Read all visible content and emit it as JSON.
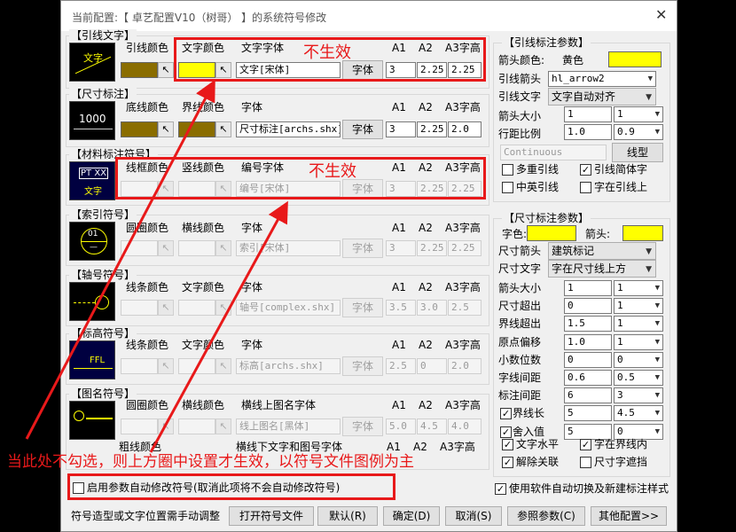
{
  "window": {
    "title": "当前配置:【 卓艺配置V10（树哥） 】的系统符号修改",
    "close": "✕"
  },
  "sections": {
    "leader_text": {
      "legend": "【引线文字】",
      "line_color": "引线颜色",
      "text_color": "文字颜色",
      "text_font": "文字字体",
      "font_value": "文字[宋体]",
      "font_btn": "字体",
      "a1": "A1",
      "a2": "A2",
      "a3": "A3字高",
      "a1_val": "3",
      "a2_val": "2.25",
      "a3_val": "2.25",
      "thumb_text": "文字",
      "swatch_line": "#8a6d00",
      "swatch_text": "#ffff00"
    },
    "dimension": {
      "legend": "【尺寸标注】",
      "base_color": "底线颜色",
      "ext_color": "界线颜色",
      "font": "字体",
      "font_value": "尺寸标注[archs.shx]",
      "font_btn": "字体",
      "a1": "A1",
      "a2": "A2",
      "a3": "A3字高",
      "a1_val": "3",
      "a2_val": "2.25",
      "a3_val": "2.0",
      "thumb_text": "1000",
      "swatch": "#8a6d00"
    },
    "material": {
      "legend": "【材料标注符号】",
      "frame_color": "线框颜色",
      "vline_color": "竖线颜色",
      "num_font": "编号字体",
      "font_value": "编号[宋体]",
      "font_btn": "字体",
      "a1": "A1",
      "a2": "A2",
      "a3": "A3字高",
      "a1_val": "3",
      "a2_val": "2.25",
      "a3_val": "2.25",
      "thumb_top": "PT XX",
      "thumb_bottom": "文字"
    },
    "index": {
      "legend": "【索引符号】",
      "circle_color": "圆圈颜色",
      "line_color": "横线颜色",
      "font": "字体",
      "font_value": "索引[宋体]",
      "font_btn": "字体",
      "a1": "A1",
      "a2": "A2",
      "a3": "A3字高",
      "a1_val": "3",
      "a2_val": "2.25",
      "a3_val": "2.25",
      "thumb_top": "01",
      "thumb_bottom": "—"
    },
    "axis": {
      "legend": "【轴号符号】",
      "line_color": "线条颜色",
      "text_color": "文字颜色",
      "font": "字体",
      "font_value": "轴号[complex.shx]",
      "font_btn": "字体",
      "a1": "A1",
      "a2": "A2",
      "a3": "A3字高",
      "a1_val": "3.5",
      "a2_val": "3.0",
      "a3_val": "2.5"
    },
    "elevation": {
      "legend": "【标高符号】",
      "line_color": "线条颜色",
      "text_color": "文字颜色",
      "font": "字体",
      "font_value": "标高[archs.shx]",
      "font_btn": "字体",
      "a1": "A1",
      "a2": "A2",
      "a3": "A3字高",
      "a1_val": "2.5",
      "a2_val": "0",
      "a3_val": "2.0",
      "thumb_text": "FFL"
    },
    "drawing_name": {
      "legend": "【图名符号】",
      "circle_color": "圆圈颜色",
      "line_color": "横线颜色",
      "top_font": "横线上图名字体",
      "font_value": "线上图名[黑体]",
      "font_btn": "字体",
      "a1": "A1",
      "a2": "A2",
      "a3": "A3字高",
      "a1_val": "5.0",
      "a2_val": "4.5",
      "a3_val": "4.0",
      "thick_color": "粗线颜色",
      "bottom_font": "横线下文字和图号字体",
      "b_a1": "A1",
      "b_a2": "A2",
      "b_a3": "A3字高"
    }
  },
  "leader_params": {
    "legend": "【引线标注参数】",
    "arrow_color_label": "箭头颜色:",
    "arrow_color_name": "黄色",
    "arrow_color": "#ffff00",
    "arrow_label": "引线箭头",
    "arrow_value": "hl_arrow2",
    "text_label": "引线文字",
    "text_value": "文字自动对齐",
    "size_label": "箭头大小",
    "size_value": "1",
    "size_sel": "1",
    "ratio_label": "行距比例",
    "ratio_value": "1.0",
    "ratio_sel": "0.9",
    "linetype_value": "Continuous",
    "linetype_btn": "线型",
    "cb_multi": "多重引线",
    "cb_simple": "引线简体字",
    "cb_cn_en": "中英引线",
    "cb_on_line": "字在引线上"
  },
  "dim_params": {
    "legend": "【尺寸标注参数】",
    "text_color_label": "字色:",
    "arrow_color_label": "箭头:",
    "text_color": "#ffff00",
    "arrow_color": "#ffff00",
    "arrow_label": "尺寸箭头",
    "arrow_value": "建筑标记",
    "text_label": "尺寸文字",
    "text_value": "字在尺寸线上方",
    "rows": [
      {
        "label": "箭头大小",
        "value": "1",
        "sel": "1"
      },
      {
        "label": "尺寸超出",
        "value": "0",
        "sel": "1"
      },
      {
        "label": "界线超出",
        "value": "1.5",
        "sel": "1"
      },
      {
        "label": "原点偏移",
        "value": "1.0",
        "sel": "1"
      },
      {
        "label": "小数位数",
        "value": "0",
        "sel": "0"
      },
      {
        "label": "字线间距",
        "value": "0.6",
        "sel": "0.5"
      },
      {
        "label": "标注间距",
        "value": "6",
        "sel": "3"
      },
      {
        "label": "界线长",
        "value": "5",
        "sel": "4.5"
      },
      {
        "label": "舍入值",
        "value": "5",
        "sel": "0"
      }
    ],
    "cb_horizontal": "文字水平",
    "cb_in_line": "字在界线内",
    "cb_unlink": "解除关联",
    "cb_mask": "尺寸字遮挡"
  },
  "footer": {
    "auto_modify": "启用参数自动修改符号(取消此项将不会自动修改符号)",
    "auto_switch": "使用软件自动切换及新建标注样式",
    "note": "符号造型或文字位置需手动调整",
    "open_btn": "打开符号文件",
    "default_btn": "默认(R)",
    "ok_btn": "确定(D)",
    "cancel_btn": "取消(S)",
    "ref_btn": "参照参数(C)",
    "other_btn": "其他配置>>"
  },
  "annotations": {
    "no_effect_1": "不生效",
    "no_effect_2": "不生效",
    "bottom_note": "当此处不勾选，则上方圈中设置才生效，以符号文件图例为主",
    "red": "#e8191a"
  }
}
